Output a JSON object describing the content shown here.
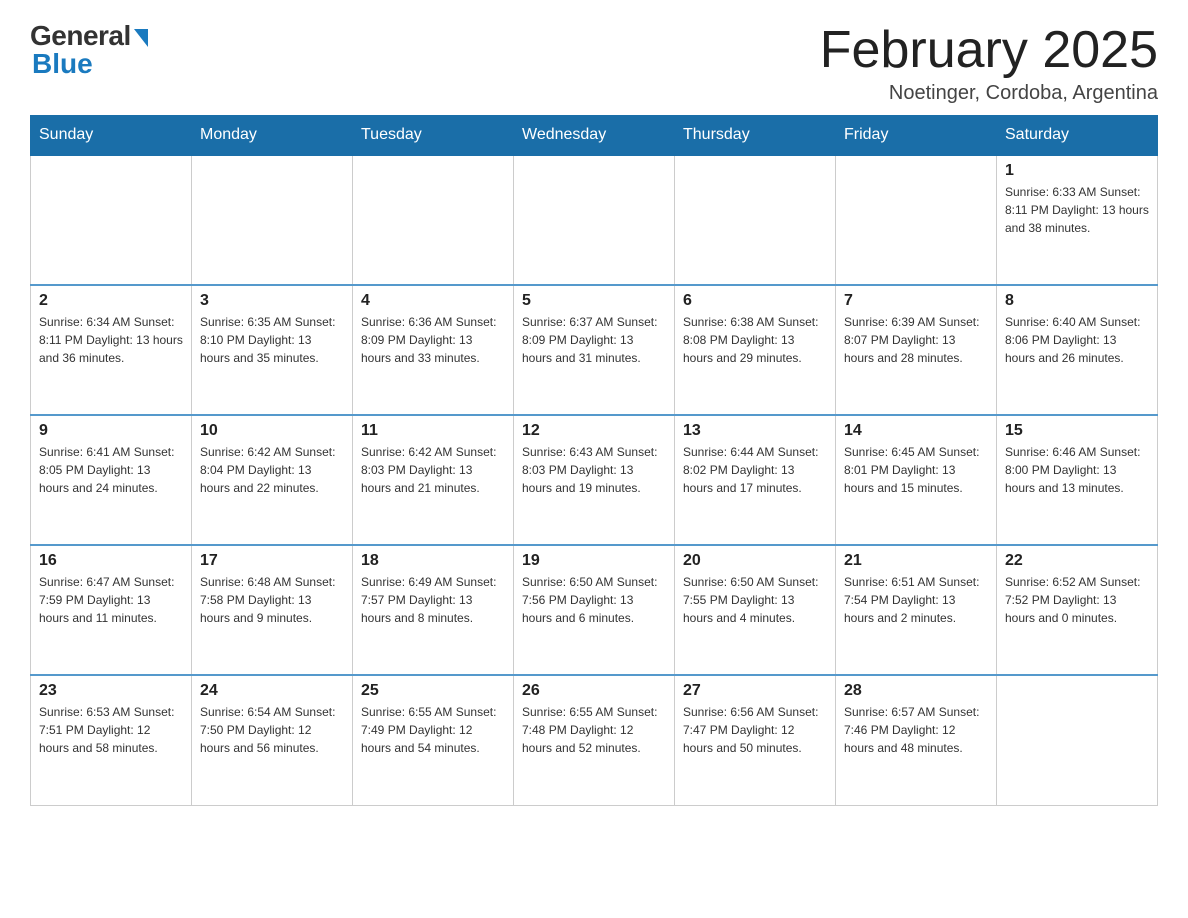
{
  "header": {
    "logo_general": "General",
    "logo_blue": "Blue",
    "month_title": "February 2025",
    "location": "Noetinger, Cordoba, Argentina"
  },
  "weekdays": [
    "Sunday",
    "Monday",
    "Tuesday",
    "Wednesday",
    "Thursday",
    "Friday",
    "Saturday"
  ],
  "weeks": [
    [
      {
        "day": "",
        "info": ""
      },
      {
        "day": "",
        "info": ""
      },
      {
        "day": "",
        "info": ""
      },
      {
        "day": "",
        "info": ""
      },
      {
        "day": "",
        "info": ""
      },
      {
        "day": "",
        "info": ""
      },
      {
        "day": "1",
        "info": "Sunrise: 6:33 AM\nSunset: 8:11 PM\nDaylight: 13 hours and 38 minutes."
      }
    ],
    [
      {
        "day": "2",
        "info": "Sunrise: 6:34 AM\nSunset: 8:11 PM\nDaylight: 13 hours and 36 minutes."
      },
      {
        "day": "3",
        "info": "Sunrise: 6:35 AM\nSunset: 8:10 PM\nDaylight: 13 hours and 35 minutes."
      },
      {
        "day": "4",
        "info": "Sunrise: 6:36 AM\nSunset: 8:09 PM\nDaylight: 13 hours and 33 minutes."
      },
      {
        "day": "5",
        "info": "Sunrise: 6:37 AM\nSunset: 8:09 PM\nDaylight: 13 hours and 31 minutes."
      },
      {
        "day": "6",
        "info": "Sunrise: 6:38 AM\nSunset: 8:08 PM\nDaylight: 13 hours and 29 minutes."
      },
      {
        "day": "7",
        "info": "Sunrise: 6:39 AM\nSunset: 8:07 PM\nDaylight: 13 hours and 28 minutes."
      },
      {
        "day": "8",
        "info": "Sunrise: 6:40 AM\nSunset: 8:06 PM\nDaylight: 13 hours and 26 minutes."
      }
    ],
    [
      {
        "day": "9",
        "info": "Sunrise: 6:41 AM\nSunset: 8:05 PM\nDaylight: 13 hours and 24 minutes."
      },
      {
        "day": "10",
        "info": "Sunrise: 6:42 AM\nSunset: 8:04 PM\nDaylight: 13 hours and 22 minutes."
      },
      {
        "day": "11",
        "info": "Sunrise: 6:42 AM\nSunset: 8:03 PM\nDaylight: 13 hours and 21 minutes."
      },
      {
        "day": "12",
        "info": "Sunrise: 6:43 AM\nSunset: 8:03 PM\nDaylight: 13 hours and 19 minutes."
      },
      {
        "day": "13",
        "info": "Sunrise: 6:44 AM\nSunset: 8:02 PM\nDaylight: 13 hours and 17 minutes."
      },
      {
        "day": "14",
        "info": "Sunrise: 6:45 AM\nSunset: 8:01 PM\nDaylight: 13 hours and 15 minutes."
      },
      {
        "day": "15",
        "info": "Sunrise: 6:46 AM\nSunset: 8:00 PM\nDaylight: 13 hours and 13 minutes."
      }
    ],
    [
      {
        "day": "16",
        "info": "Sunrise: 6:47 AM\nSunset: 7:59 PM\nDaylight: 13 hours and 11 minutes."
      },
      {
        "day": "17",
        "info": "Sunrise: 6:48 AM\nSunset: 7:58 PM\nDaylight: 13 hours and 9 minutes."
      },
      {
        "day": "18",
        "info": "Sunrise: 6:49 AM\nSunset: 7:57 PM\nDaylight: 13 hours and 8 minutes."
      },
      {
        "day": "19",
        "info": "Sunrise: 6:50 AM\nSunset: 7:56 PM\nDaylight: 13 hours and 6 minutes."
      },
      {
        "day": "20",
        "info": "Sunrise: 6:50 AM\nSunset: 7:55 PM\nDaylight: 13 hours and 4 minutes."
      },
      {
        "day": "21",
        "info": "Sunrise: 6:51 AM\nSunset: 7:54 PM\nDaylight: 13 hours and 2 minutes."
      },
      {
        "day": "22",
        "info": "Sunrise: 6:52 AM\nSunset: 7:52 PM\nDaylight: 13 hours and 0 minutes."
      }
    ],
    [
      {
        "day": "23",
        "info": "Sunrise: 6:53 AM\nSunset: 7:51 PM\nDaylight: 12 hours and 58 minutes."
      },
      {
        "day": "24",
        "info": "Sunrise: 6:54 AM\nSunset: 7:50 PM\nDaylight: 12 hours and 56 minutes."
      },
      {
        "day": "25",
        "info": "Sunrise: 6:55 AM\nSunset: 7:49 PM\nDaylight: 12 hours and 54 minutes."
      },
      {
        "day": "26",
        "info": "Sunrise: 6:55 AM\nSunset: 7:48 PM\nDaylight: 12 hours and 52 minutes."
      },
      {
        "day": "27",
        "info": "Sunrise: 6:56 AM\nSunset: 7:47 PM\nDaylight: 12 hours and 50 minutes."
      },
      {
        "day": "28",
        "info": "Sunrise: 6:57 AM\nSunset: 7:46 PM\nDaylight: 12 hours and 48 minutes."
      },
      {
        "day": "",
        "info": ""
      }
    ]
  ]
}
